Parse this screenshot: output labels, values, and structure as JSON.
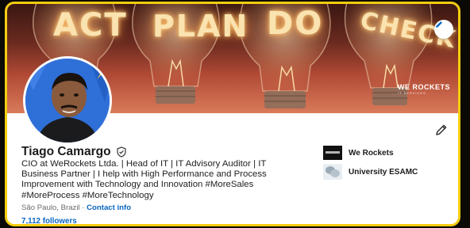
{
  "banner": {
    "words": [
      "ACT",
      "PLAN",
      "DO",
      "CHECK"
    ],
    "logo_text": "WE ROCKETS",
    "logo_subtext": "IT SERVICES"
  },
  "profile": {
    "name": "Tiago Camargo",
    "headline": "CIO at WeRockets Ltda. | Head of IT | IT Advisory Auditor | IT Business Partner | I help with High Performance and Process Improvement with Technology and Innovation #MoreSales #MoreProcess #MoreTechnology",
    "location": "São Paulo, Brazil",
    "separator": " · ",
    "contact_label": "Contact info",
    "followers": "7,112 followers"
  },
  "organizations": [
    {
      "name": "We Rockets",
      "icon": "we-rockets-logo"
    },
    {
      "name": "University ESAMC",
      "icon": "university-logo"
    }
  ],
  "colors": {
    "frame": "#f3cd10",
    "link": "#0a66c2",
    "avatar_bg": "#2f6fd8"
  },
  "icons": {
    "edit_banner": "pencil-icon",
    "edit_profile": "pencil-icon",
    "verified": "shield-check-icon"
  }
}
